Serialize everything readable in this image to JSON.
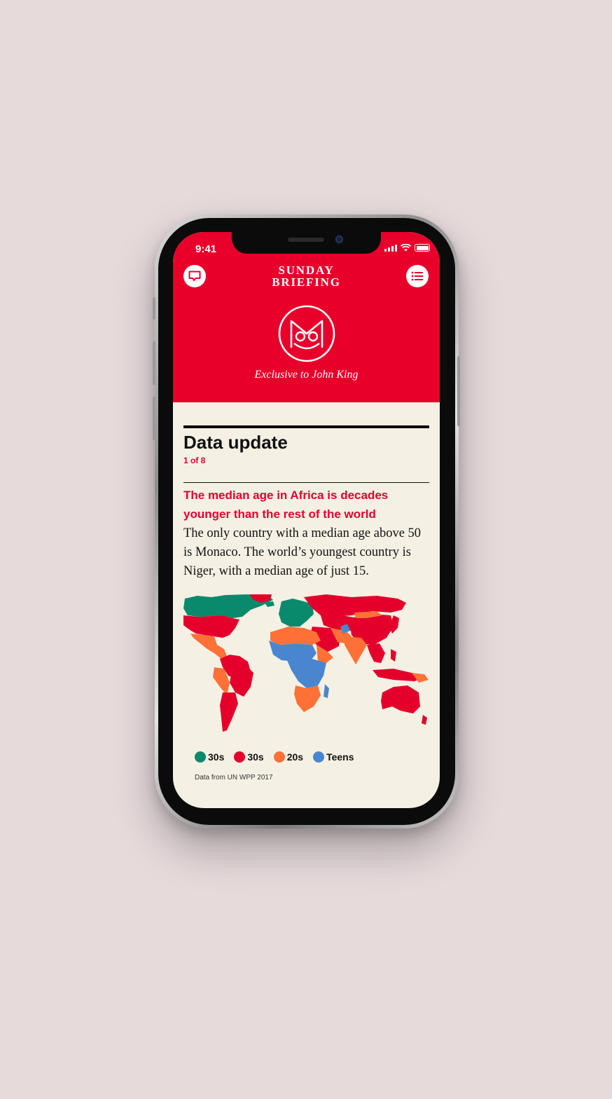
{
  "status_bar": {
    "time": "9:41"
  },
  "header": {
    "brand_line1": "SUNDAY",
    "brand_line2": "BRIEFING",
    "subtitle": "Exclusive to John King",
    "left_icon": "chat-bubble-icon",
    "right_icon": "menu-list-icon",
    "background": "#e8002b"
  },
  "article": {
    "section_title": "Data update",
    "counter": "1 of 8",
    "headline": "The median age in Africa is decades younger than the rest of the world",
    "body": "The only country with a median age above 50 is Monaco. The world’s youngest country is Niger, with a median age of just 15."
  },
  "map": {
    "legend": [
      {
        "label": "30s",
        "color": "#0a8a6c"
      },
      {
        "label": "30s",
        "color": "#e4002b"
      },
      {
        "label": "20s",
        "color": "#ff7137"
      },
      {
        "label": "Teens",
        "color": "#4a86cf"
      }
    ],
    "source": "Data from UN WPP 2017"
  },
  "colors": {
    "accent": "#e8002b",
    "paper": "#f4f1e4",
    "page_background": "#e6dadb"
  }
}
